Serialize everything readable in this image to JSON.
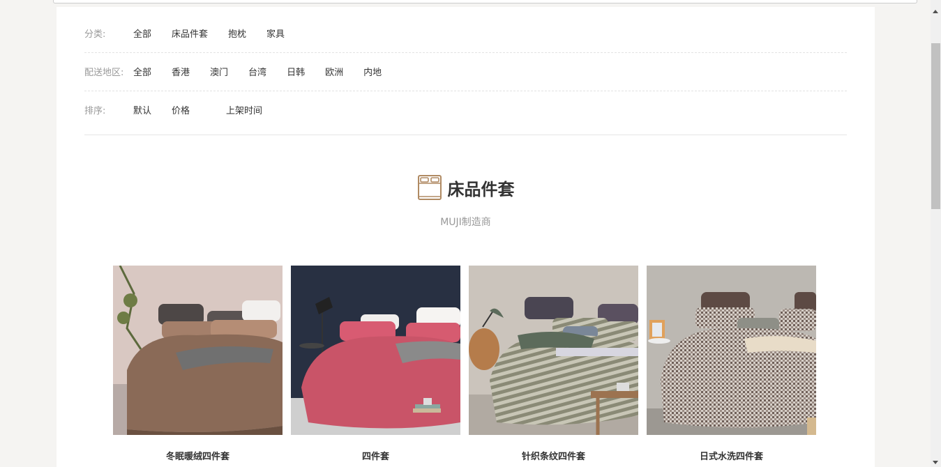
{
  "filters": {
    "category": {
      "label": "分类:",
      "options": [
        "全部",
        "床品件套",
        "抱枕",
        "家具"
      ]
    },
    "region": {
      "label": "配送地区:",
      "options": [
        "全部",
        "香港",
        "澳门",
        "台湾",
        "日韩",
        "欧洲",
        "内地"
      ]
    },
    "sort": {
      "label": "排序:",
      "options": [
        "默认",
        "价格",
        "上架时间"
      ]
    }
  },
  "section": {
    "icon": "bed-icon",
    "title": "床品件套",
    "subtitle": "MUJI制造商"
  },
  "products": [
    {
      "name": "冬眠暖绒四件套",
      "palette": {
        "wall": "#d9c8c2",
        "sheet": "#8a6a57",
        "pillow": "#4d4746",
        "accent": "#f2f0ee"
      }
    },
    {
      "name": "四件套",
      "palette": {
        "wall": "#283042",
        "sheet": "#c95468",
        "pillow": "#e8e4e2",
        "accent": "#8a8a8a"
      }
    },
    {
      "name": "针织条纹四件套",
      "palette": {
        "wall": "#cbc4bc",
        "sheet": "#7f7f6d",
        "pillow": "#4a4552",
        "accent": "#5c6b5b"
      }
    },
    {
      "name": "日式水洗四件套",
      "palette": {
        "wall": "#bcb8b2",
        "sheet": "#8c8078",
        "pillow": "#5d4a44",
        "accent": "#e8dcc8"
      }
    }
  ]
}
